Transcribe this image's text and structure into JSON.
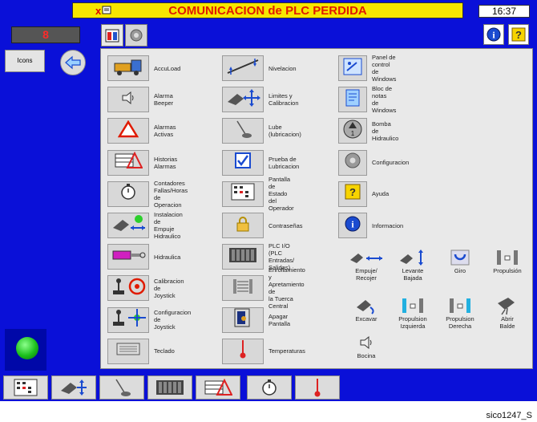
{
  "header": {
    "alarm_text": "COMUNICACION de PLC PERDIDA",
    "alarm_x": "x",
    "clock": "16:37",
    "counter": "8"
  },
  "left": {
    "icons_label": "Icons"
  },
  "menu_col1": [
    {
      "label": "AccuLoad",
      "icon": "truck-icon"
    },
    {
      "label": "Alarma\nBeeper",
      "icon": "speaker-icon"
    },
    {
      "label": "Alarmas\nActivas",
      "icon": "warning-triangle-icon"
    },
    {
      "label": "Historias\nAlarmas",
      "icon": "alarm-history-icon"
    },
    {
      "label": "Contadores\nFallas/Horas\nde Operacion",
      "icon": "stopwatch-icon"
    },
    {
      "label": "Instalacion de\nEmpuje Hidraulico",
      "icon": "hydraulic-push-icon"
    },
    {
      "label": "Hidraulica",
      "icon": "hydraulic-cylinder-icon"
    },
    {
      "label": "Calibracion de\nJoystick",
      "icon": "joystick-target-icon"
    },
    {
      "label": "Configuracion de\nJoystick",
      "icon": "joystick-arrows-icon"
    },
    {
      "label": "Teclado",
      "icon": "keyboard-icon"
    }
  ],
  "menu_col2": [
    {
      "label": "Nivelacion",
      "icon": "leveling-icon"
    },
    {
      "label": "Limites y\nCalibracion",
      "icon": "limits-icon"
    },
    {
      "label": "Lube (lubricacion)",
      "icon": "lube-icon"
    },
    {
      "label": "Prueba de\nLubricacion",
      "icon": "checkbox-icon"
    },
    {
      "label": "Pantalla de\nEstado del\nOperador",
      "icon": "status-screen-icon"
    },
    {
      "label": "Contraseñas",
      "icon": "lock-icon"
    },
    {
      "label": "PLC I/O\n(PLC Entradas/\nSalidas)",
      "icon": "plc-io-icon"
    },
    {
      "label": "Enrollamiento y\nApretamiento de\nla Tuerca Central",
      "icon": "center-nut-icon"
    },
    {
      "label": "Apagar Pantalla",
      "icon": "screen-off-icon"
    },
    {
      "label": "Temperaturas",
      "icon": "thermometer-icon"
    }
  ],
  "menu_col3": [
    {
      "label": "Panel de control\nde Windows",
      "icon": "control-panel-icon"
    },
    {
      "label": "Bloc de notas\nde Windows",
      "icon": "notepad-icon"
    },
    {
      "label": "Bomba de\nHidraulico",
      "icon": "pump-icon"
    },
    {
      "label": "Configuracion",
      "icon": "gear-icon"
    },
    {
      "label": "Ayuda",
      "icon": "help-icon"
    },
    {
      "label": "Informacion",
      "icon": "info-icon"
    }
  ],
  "shortcuts_row1": [
    {
      "label": "Empuje/\nRecojer",
      "icon": "push-retract-icon"
    },
    {
      "label": "Levante\nBajada",
      "icon": "hoist-icon"
    },
    {
      "label": "Giro",
      "icon": "swing-icon"
    },
    {
      "label": "Propulsión",
      "icon": "propel-icon"
    }
  ],
  "shortcuts_row2": [
    {
      "label": "Excavar",
      "icon": "dig-icon"
    },
    {
      "label": "Propulsion\nIzquierda",
      "icon": "propel-left-icon"
    },
    {
      "label": "Propulsion\nDerecha",
      "icon": "propel-right-icon"
    },
    {
      "label": "Abrir\nBalde",
      "icon": "open-bucket-icon"
    }
  ],
  "shortcuts_row3": [
    {
      "label": "Bocina",
      "icon": "horn-icon"
    }
  ],
  "caption": "sico1247_S",
  "colors": {
    "screen_bg": "#0a10d8",
    "alarm_bg": "#f7e600",
    "alarm_text": "#e01a00",
    "led": "#1bbf1b"
  }
}
